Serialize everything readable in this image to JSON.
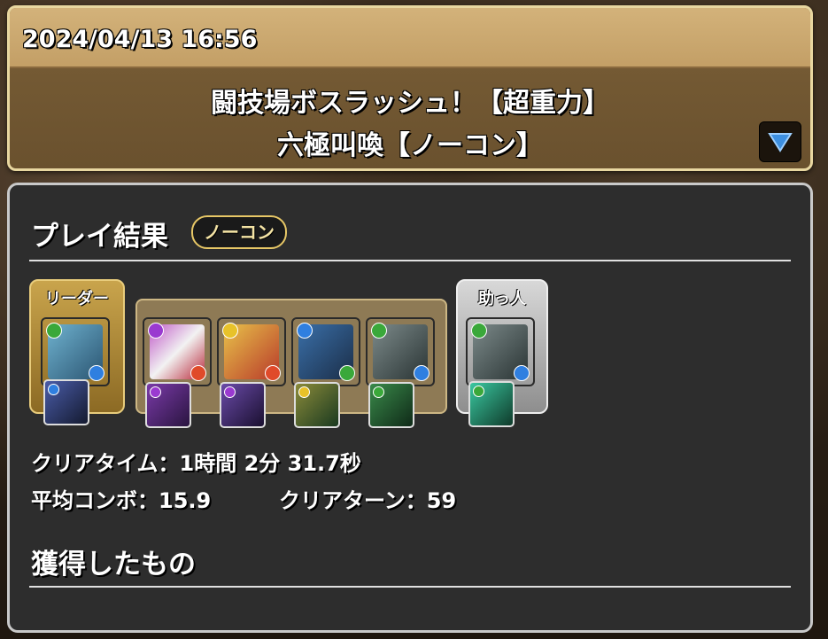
{
  "header": {
    "datetime": "2024/04/13 16:56",
    "title_line1": "闘技場ボスラッシュ！【超重力】",
    "title_line2": "六極叫喚【ノーコン】"
  },
  "result": {
    "section_title": "プレイ結果",
    "badge": "ノーコン",
    "leader_label": "リーダー",
    "helper_label": "助っ人",
    "clear_time": "クリアタイム：1時間 2分 31.7秒",
    "avg_combo": "平均コンボ：15.9",
    "clear_turns": "クリアターン：59",
    "rewards_title": "獲得したもの"
  },
  "team": [
    {
      "slot": "leader",
      "attr": "wood",
      "subattr": "water",
      "color": "#3f7a9b"
    },
    {
      "slot": "sub1",
      "attr": "dark",
      "subattr": "fire",
      "color": "#7a3a8a"
    },
    {
      "slot": "sub2",
      "attr": "light",
      "subattr": "fire",
      "color": "#c9a030"
    },
    {
      "slot": "sub3",
      "attr": "water",
      "subattr": "wood",
      "color": "#2d5a7a"
    },
    {
      "slot": "sub4",
      "attr": "wood",
      "subattr": "water",
      "color": "#4a5a5a"
    },
    {
      "slot": "helper",
      "attr": "wood",
      "subattr": "water",
      "color": "#4a5a5a"
    }
  ],
  "attr_colors": {
    "wood": "#3aa83a",
    "water": "#2f7fe0",
    "fire": "#e04a2a",
    "light": "#e8c22a",
    "dark": "#9a3ad0"
  }
}
